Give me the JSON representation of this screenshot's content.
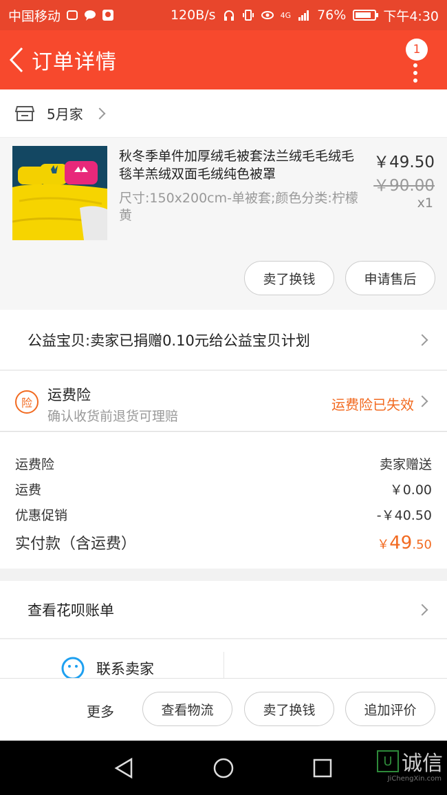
{
  "status_bar": {
    "carrier": "中国移动",
    "speed": "120B/s",
    "network": "4G",
    "battery": "76%",
    "time": "下午4:30"
  },
  "header": {
    "title": "订单详情",
    "badge_count": "1"
  },
  "shop": {
    "name": "5月家"
  },
  "item": {
    "title": "秋冬季单件加厚绒毛被套法兰绒毛毛绒毛毯羊羔绒双面毛绒纯色被罩",
    "spec": "尺寸:150x200cm-单被套;颜色分类:柠檬黄",
    "price": "￥49.50",
    "original_price": "￥90.00",
    "quantity": "x1",
    "buttons": [
      "卖了换钱",
      "申请售后"
    ]
  },
  "charity": {
    "text": "公益宝贝:卖家已捐赠0.10元给公益宝贝计划"
  },
  "insurance": {
    "icon_char": "险",
    "title": "运费险",
    "subtitle": "确认收货前退货可理赔",
    "status": "运费险已失效"
  },
  "fees": [
    {
      "label": "运费险",
      "value": "卖家赠送"
    },
    {
      "label": "运费",
      "value": "￥0.00"
    },
    {
      "label": "优惠促销",
      "value": "-￥40.50"
    }
  ],
  "total": {
    "label": "实付款（含运费）",
    "currency": "￥",
    "integer": "49",
    "decimal": ".50"
  },
  "huabei": {
    "text": "查看花呗账单"
  },
  "contact": {
    "label": "联系卖家"
  },
  "bottom_bar": {
    "more_label": "更多",
    "buttons": [
      "查看物流",
      "卖了换钱",
      "追加评价"
    ]
  },
  "watermark": {
    "text": "诚信",
    "box_char": "U",
    "sub": "JiChengXin.com"
  },
  "colors": {
    "brand": "#f7492d",
    "accent": "#f26a20"
  }
}
